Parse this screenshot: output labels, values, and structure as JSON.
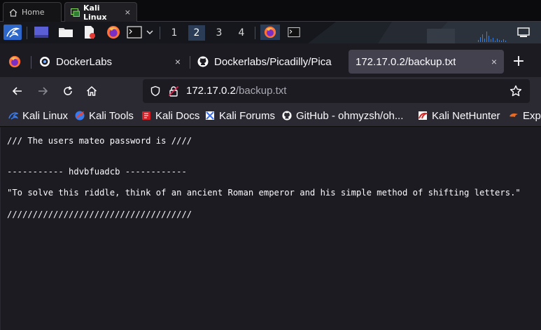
{
  "vm_tabs": [
    {
      "label": "Home",
      "icon": "home-icon"
    },
    {
      "label": "Kali Linux",
      "icon": "vm-icon",
      "close": "×"
    }
  ],
  "panel": {
    "workspaces": [
      "1",
      "2",
      "3",
      "4"
    ],
    "active_workspace": "2"
  },
  "browser_tabs": [
    {
      "label": "DockerLabs",
      "close": "×"
    },
    {
      "label": "Dockerlabs/Picadilly/Picadilly",
      "close": "×"
    },
    {
      "label": "172.17.0.2/backup.txt",
      "close": "×"
    }
  ],
  "new_tab": "+",
  "address": {
    "host": "172.17.0.2",
    "path": "/backup.txt"
  },
  "bookmarks": [
    {
      "label": "Kali Linux",
      "color": "#367bf0"
    },
    {
      "label": "Kali Tools",
      "color": "#e0483d"
    },
    {
      "label": "Kali Docs",
      "color": "#d71f26"
    },
    {
      "label": "Kali Forums",
      "color": "#3a6ff0"
    },
    {
      "label": "GitHub - ohmyzsh/oh...",
      "color": "#ffffff"
    },
    {
      "label": "Kali NetHunter",
      "color": "#d02b2b"
    },
    {
      "label": "Exploit-DB",
      "color": "#ea6a1f"
    }
  ],
  "file_lines": [
    "/// The users mateo password is ////",
    "----------- hdvbfuadcb ------------",
    "\"To solve this riddle, think of an ancient Roman emperor and his simple method of shifting letters.\"",
    "////////////////////////////////////"
  ],
  "colors": {
    "accent_blue": "#367bf0",
    "page_bg": "#1c1b22",
    "toolbar_bg": "#2b2a33",
    "active_tab_bg": "#42414d"
  }
}
